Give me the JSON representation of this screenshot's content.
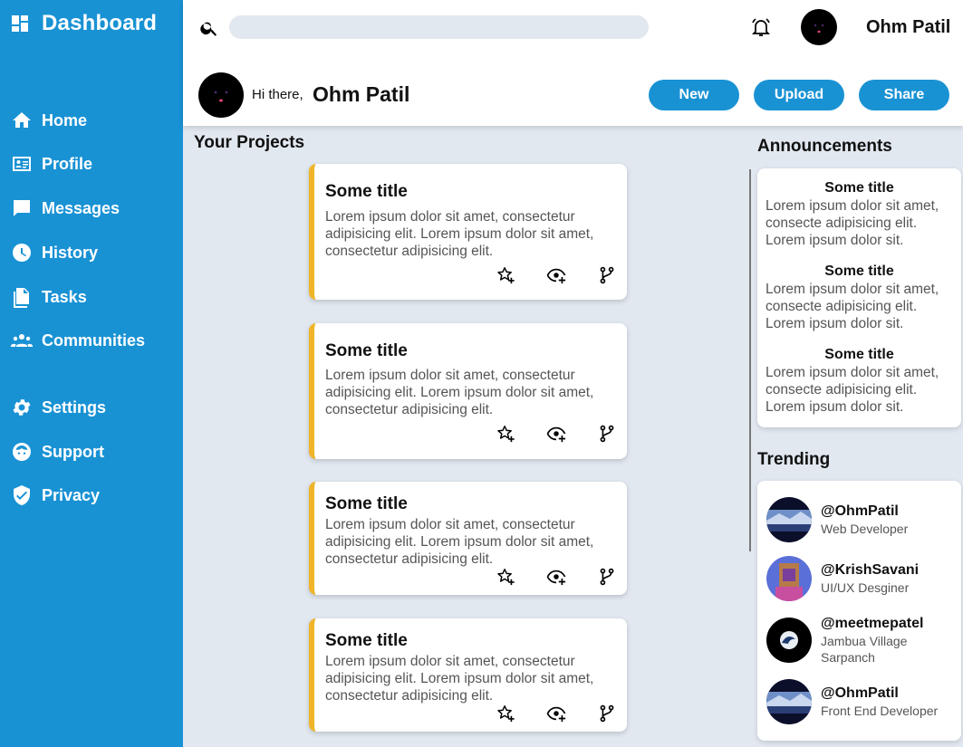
{
  "sidebar": {
    "brand": "Dashboard",
    "items": [
      {
        "label": "Home",
        "icon": "home-icon"
      },
      {
        "label": "Profile",
        "icon": "id-card-icon"
      },
      {
        "label": "Messages",
        "icon": "message-icon"
      },
      {
        "label": "History",
        "icon": "clock-icon"
      },
      {
        "label": "Tasks",
        "icon": "document-icon"
      },
      {
        "label": "Communities",
        "icon": "group-icon"
      },
      {
        "label": "Settings",
        "icon": "gear-icon"
      },
      {
        "label": "Support",
        "icon": "support-icon"
      },
      {
        "label": "Privacy",
        "icon": "shield-icon"
      }
    ]
  },
  "header": {
    "search": {
      "value": "",
      "placeholder": ""
    },
    "username": "Ohm Patil",
    "greeting": "Hi there,",
    "greeting_name": "Ohm Patil",
    "buttons": {
      "new": "New",
      "upload": "Upload",
      "share": "Share"
    }
  },
  "projects": {
    "heading": "Your Projects",
    "cards": [
      {
        "title": "Some title",
        "desc": "Lorem ipsum dolor sit amet, consectetur adipisicing elit. Lorem ipsum dolor sit amet, consectetur adipisicing elit."
      },
      {
        "title": "Some title",
        "desc": "Lorem ipsum dolor sit amet, consectetur adipisicing elit. Lorem ipsum dolor sit amet, consectetur adipisicing elit."
      },
      {
        "title": "Some title",
        "desc": "Lorem ipsum dolor sit amet, consectetur adipisicing elit. Lorem ipsum dolor sit amet, consectetur adipisicing elit."
      },
      {
        "title": "Some title",
        "desc": "Lorem ipsum dolor sit amet, consectetur adipisicing elit. Lorem ipsum dolor sit amet, consectetur adipisicing elit."
      }
    ]
  },
  "announcements": {
    "heading": "Announcements",
    "items": [
      {
        "title": "Some title",
        "desc": "Lorem ipsum dolor sit amet, consecte adipisicing elit. Lorem ipsum dolor sit."
      },
      {
        "title": "Some title",
        "desc": "Lorem ipsum dolor sit amet, consecte adipisicing elit. Lorem ipsum dolor sit."
      },
      {
        "title": "Some title",
        "desc": "Lorem ipsum dolor sit amet, consecte adipisicing elit. Lorem ipsum dolor sit."
      }
    ]
  },
  "trending": {
    "heading": "Trending",
    "users": [
      {
        "handle": "@OhmPatil",
        "role": "Web Developer"
      },
      {
        "handle": "@KrishSavani",
        "role": "UI/UX Desginer"
      },
      {
        "handle": "@meetmepatel",
        "role": "Jambua Village Sarpanch"
      },
      {
        "handle": "@OhmPatil",
        "role": "Front End Developer"
      }
    ]
  },
  "colors": {
    "sidebar": "#1992d4",
    "accent": "#f0b429",
    "background": "#e2e8f0"
  }
}
